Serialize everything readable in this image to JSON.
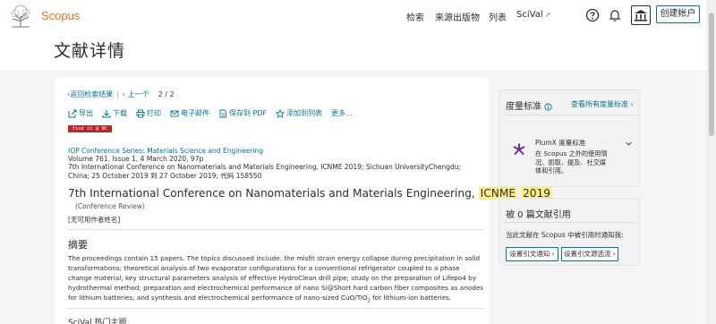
{
  "header": {
    "brand": "Scopus",
    "nav": [
      "检索",
      "来源出版物",
      "列表",
      "SciVal"
    ],
    "nav_external_marker": "↗",
    "create_account": "创建帐户"
  },
  "page_title": "文献详情",
  "navigation": {
    "back_to_results": "返回检索结果",
    "previous": "上一个",
    "page_counter": "2 / 2"
  },
  "actions": [
    {
      "label": "导出",
      "icon": "export-icon"
    },
    {
      "label": "下载",
      "icon": "download-icon"
    },
    {
      "label": "打印",
      "icon": "print-icon"
    },
    {
      "label": "电子邮件",
      "icon": "email-icon"
    },
    {
      "label": "保存到 PDF",
      "icon": "pdf-icon"
    },
    {
      "label": "添加到列表",
      "icon": "star-icon"
    },
    {
      "label": "更多...",
      "icon": ""
    }
  ],
  "find_badge": "find it @ BC",
  "document": {
    "source_title": "IOP Conference Series: Materials Science and Engineering",
    "meta_line1": "Volume 761, Issue 1, 4 March 2020, 97p",
    "meta_line2": "7th International Conference on Nanomaterials and Materials Engineering, ICNME 2019; Sichuan UniversityChengdu;",
    "meta_line3": "China; 25 October 2019 到 27 October 2019; 代码 158550",
    "title_main": "7th International Conference on Nanomaterials and Materials Engineering,",
    "title_hl1": "ICNME",
    "title_hl2": "2019",
    "doc_type": "(Conference Review)",
    "no_author": "[无可用作者姓名]"
  },
  "abstract": {
    "heading": "摘要",
    "text_part1": "The proceedings contain 15 papers. The topics discussed include: the misfit strain energy collapse during precipitation in solid transformations; theoretical analysis of two evaporator configurations for a conventional refrigerator coupled to a phase change material; key structural parameters analysis of effective HydroClean drill pipe; study on the preparation of Lifepo4 by hydrothermal method; preparation and electrochemical performance of nano Si@Short hard carbon fiber composites as anodes for lithium batteries; and synthesis and electrochemical performance of nano-sized CuO/TiO",
    "text_sub": "2",
    "text_part2": " for lithium-ion batteries."
  },
  "scival_heading": "SciVal 热门主题",
  "metrics": {
    "title": "度量标准",
    "all_metrics": "查看所有度量标准",
    "plumx_title": "PlumX 度量标准",
    "plumx_desc": "在 Scopus 之外的使用情况、抓取、提及、社交媒体和引用。"
  },
  "citations": {
    "title": "被 0 篇文献引用",
    "note": "当此文献在 Scopus 中被引用时通知我:",
    "btn_alert": "设置引文通知",
    "btn_feed": "设置引文源选流"
  },
  "colors": {
    "brand_orange": "#e9711c",
    "link_blue": "#007398",
    "highlight": "#ffed8a",
    "badge_red": "#b02b2b"
  }
}
